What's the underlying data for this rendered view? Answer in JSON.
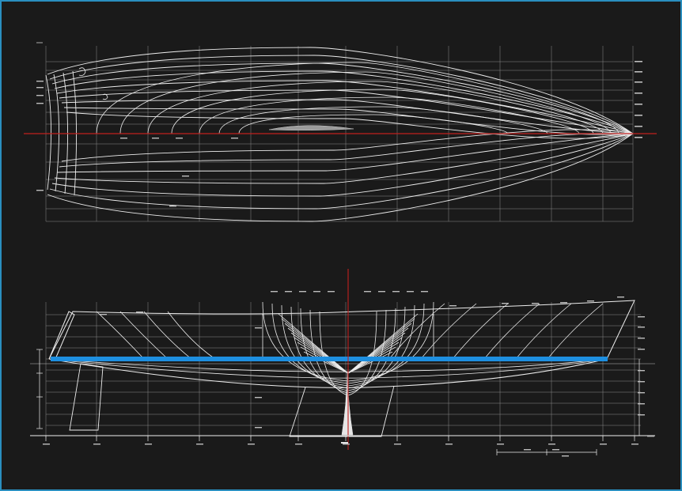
{
  "drawing": {
    "station_count": 13,
    "waterline_count": 9,
    "colors": {
      "background": "#1a1a1a",
      "border": "#2a8fbf",
      "hull_lines": "#ededed",
      "grid": "#8a8a8a",
      "centerline": "#c0201f",
      "waterline_band": "#1e8fe0"
    }
  }
}
